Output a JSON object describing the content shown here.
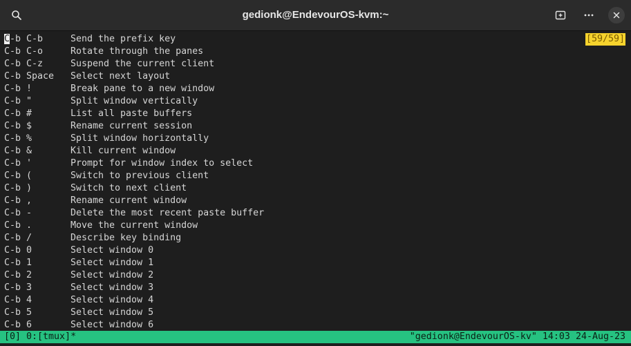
{
  "window": {
    "title": "gedionk@EndevourOS-kvm:~"
  },
  "icons": {
    "search": "search-icon",
    "new_tab": "new-tab-icon",
    "menu": "more-menu-icon",
    "close": "close-icon"
  },
  "pager": {
    "position": "[59/59]",
    "bindings": [
      {
        "key": "C-b C-b",
        "desc": "Send the prefix key"
      },
      {
        "key": "C-b C-o",
        "desc": "Rotate through the panes"
      },
      {
        "key": "C-b C-z",
        "desc": "Suspend the current client"
      },
      {
        "key": "C-b Space",
        "desc": "Select next layout"
      },
      {
        "key": "C-b !",
        "desc": "Break pane to a new window"
      },
      {
        "key": "C-b \"",
        "desc": "Split window vertically"
      },
      {
        "key": "C-b #",
        "desc": "List all paste buffers"
      },
      {
        "key": "C-b $",
        "desc": "Rename current session"
      },
      {
        "key": "C-b %",
        "desc": "Split window horizontally"
      },
      {
        "key": "C-b &",
        "desc": "Kill current window"
      },
      {
        "key": "C-b '",
        "desc": "Prompt for window index to select"
      },
      {
        "key": "C-b (",
        "desc": "Switch to previous client"
      },
      {
        "key": "C-b )",
        "desc": "Switch to next client"
      },
      {
        "key": "C-b ,",
        "desc": "Rename current window"
      },
      {
        "key": "C-b -",
        "desc": "Delete the most recent paste buffer"
      },
      {
        "key": "C-b .",
        "desc": "Move the current window"
      },
      {
        "key": "C-b /",
        "desc": "Describe key binding"
      },
      {
        "key": "C-b 0",
        "desc": "Select window 0"
      },
      {
        "key": "C-b 1",
        "desc": "Select window 1"
      },
      {
        "key": "C-b 2",
        "desc": "Select window 2"
      },
      {
        "key": "C-b 3",
        "desc": "Select window 3"
      },
      {
        "key": "C-b 4",
        "desc": "Select window 4"
      },
      {
        "key": "C-b 5",
        "desc": "Select window 5"
      },
      {
        "key": "C-b 6",
        "desc": "Select window 6"
      }
    ]
  },
  "status": {
    "left": "[0] 0:[tmux]*",
    "right": "\"gedionk@EndevourOS-kv\" 14:03 24-Aug-23"
  },
  "colors": {
    "background": "#1e1e1e",
    "titlebar": "#2b2b2b",
    "statusbar": "#26c281",
    "position_indicator": "#f6d32d"
  }
}
